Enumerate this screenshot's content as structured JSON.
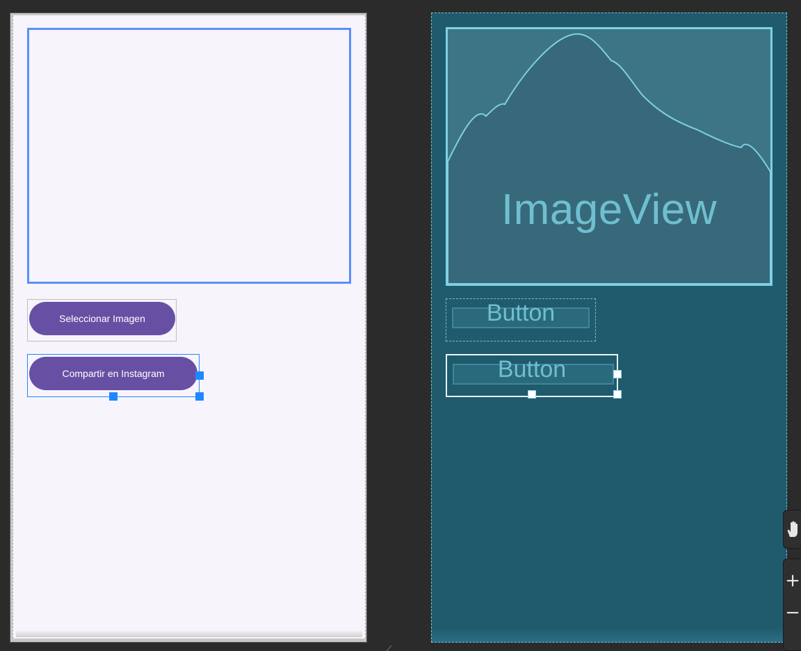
{
  "design_view": {
    "image_view": {},
    "buttons": [
      {
        "label": "Seleccionar Imagen"
      },
      {
        "label": "Compartir en Instagram"
      }
    ]
  },
  "blueprint_view": {
    "image_view_label": "ImageView",
    "buttons": [
      {
        "label": "Button"
      },
      {
        "label": "Button"
      }
    ]
  },
  "zoom_controls": {
    "pan_icon": "pan-hand-icon",
    "zoom_in_label": "+",
    "zoom_out_label": "−"
  },
  "colors": {
    "design_background": "#f8f4fc",
    "button_fill": "#6750a4",
    "selection_blue": "#1e88ff",
    "imageview_border": "#5b8ff9",
    "blueprint_background": "#1f5a6d",
    "blueprint_accent": "#6fc5d9"
  }
}
